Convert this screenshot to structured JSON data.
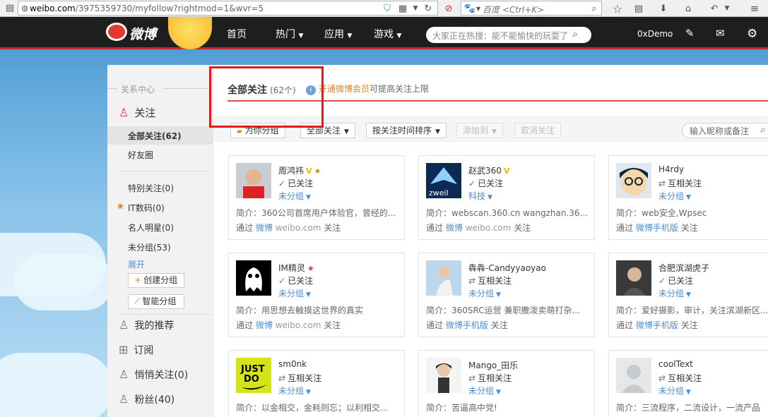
{
  "browser": {
    "url_domain": "weibo.com",
    "url_rest": "/3975359730/myfollow?rightmod=1&wvr=5",
    "search_placeholder": "百度 <Ctrl+K>"
  },
  "nav": {
    "logo": "微博",
    "items": [
      "首页",
      "热门",
      "应用",
      "游戏"
    ],
    "search_placeholder": "大家正在热搜：能不能愉快的玩耍了",
    "user": "0xDemo"
  },
  "sidebar": {
    "heading": "关系中心",
    "follow_label": "关注",
    "all_follow": "全部关注(62)",
    "friends": "好友圈",
    "groups": [
      "特别关注(0)",
      "IT数码(0)",
      "名人明星(0)",
      "未分组(53)"
    ],
    "expand": "展开",
    "create_group": "创建分组",
    "smart_group": "智能分组",
    "recommend": "我的推荐",
    "subscribe": "订阅",
    "quiet_follow": "悄悄关注(0)",
    "fans": "粉丝(40)"
  },
  "main": {
    "title": "全部关注",
    "count": "(62个)",
    "vip_link": "开通微博会员",
    "vip_text": "可提高关注上限",
    "toolbar": {
      "suggest": "为你分组",
      "all_follow": "全部关注",
      "sort": "按关注时间排序",
      "add_to": "添加到",
      "unfollow": "取消关注",
      "search_placeholder": "输入昵称或备注"
    }
  },
  "cards": [
    {
      "name": "周鸿祎",
      "badges": [
        "V",
        "★"
      ],
      "status": "已关注",
      "mutual": false,
      "group": "未分组",
      "bio": "简介：360公司首席用户体验官，曾经的...",
      "via_pre": "通过",
      "via_link": "微博",
      "via_gray": "weibo.com",
      "via_post": "关注"
    },
    {
      "name": "赵武360",
      "badges": [
        "V"
      ],
      "status": "已关注",
      "mutual": false,
      "group": "科技",
      "bio": "简介：webscan.360.cn wangzhan.360....",
      "via_pre": "通过",
      "via_link": "微博",
      "via_gray": "weibo.com",
      "via_post": "关注"
    },
    {
      "name": "H4rdy",
      "badges": [],
      "status": "互相关注",
      "mutual": true,
      "group": "未分组",
      "bio": "简介：web安全,Wpsec",
      "via_pre": "通过",
      "via_link": "微博手机版",
      "via_gray": "",
      "via_post": "关注"
    },
    {
      "name": "IM精灵",
      "badges": [
        "★"
      ],
      "status": "已关注",
      "mutual": false,
      "group": "未分组",
      "bio": "简介：用思想去触摸这世界的真实",
      "via_pre": "通过",
      "via_link": "微博",
      "via_gray": "weibo.com",
      "via_post": "关注"
    },
    {
      "name": "犇犇-Candyyaoyao",
      "badges": [],
      "status": "互相关注",
      "mutual": true,
      "group": "未分组",
      "bio": "简介：360SRC运营 兼职撒泼卖萌打杂...",
      "via_pre": "通过",
      "via_link": "微博手机版",
      "via_gray": "",
      "via_post": "关注"
    },
    {
      "name": "合肥滨湖虎子",
      "badges": [],
      "status": "已关注",
      "mutual": false,
      "group": "未分组",
      "bio": "简介：爱好摄影，审计，关注滨湖新区...",
      "via_pre": "通过",
      "via_link": "微博手机版",
      "via_gray": "",
      "via_post": "关注"
    },
    {
      "name": "sm0nk",
      "badges": [],
      "status": "互相关注",
      "mutual": true,
      "group": "未分组",
      "bio": "简介：以金相交，金耗则忘；以利相交...",
      "via_pre": "",
      "via_link": "",
      "via_gray": "",
      "via_post": ""
    },
    {
      "name": "Mango_田乐",
      "badges": [],
      "status": "互相关注",
      "mutual": true,
      "group": "未分组",
      "bio": "简介：苦逼高中党!",
      "via_pre": "",
      "via_link": "",
      "via_gray": "",
      "via_post": ""
    },
    {
      "name": "coolText",
      "badges": [],
      "status": "互相关注",
      "mutual": true,
      "group": "未分组",
      "bio": "简介：三流程序，二流设计，一流产品",
      "via_pre": "",
      "via_link": "",
      "via_gray": "",
      "via_post": ""
    }
  ]
}
